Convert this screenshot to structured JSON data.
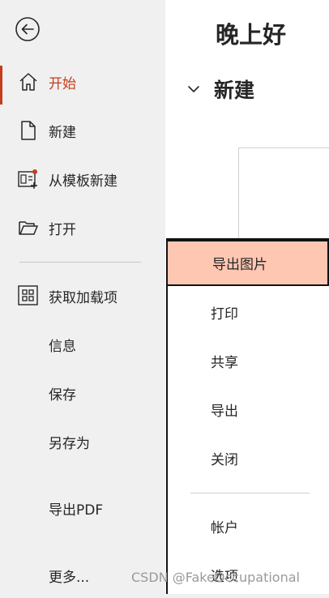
{
  "sidebar": {
    "back": {
      "icon": "back-arrow-icon"
    },
    "items": [
      {
        "label": "开始",
        "icon": "home-icon",
        "active": true
      },
      {
        "label": "新建",
        "icon": "new-document-icon"
      },
      {
        "label": "从模板新建",
        "icon": "template-icon"
      },
      {
        "label": "打开",
        "icon": "folder-open-icon"
      },
      {
        "label": "获取加载项",
        "icon": "addins-grid-icon"
      },
      {
        "label": "信息"
      },
      {
        "label": "保存"
      },
      {
        "label": "另存为"
      },
      {
        "label": "导出PDF"
      },
      {
        "label": "更多..."
      }
    ]
  },
  "main": {
    "greeting": "晚上好",
    "section_title": "新建"
  },
  "more_menu": {
    "items": [
      {
        "label": "导出图片",
        "highlighted": true
      },
      {
        "label": "打印"
      },
      {
        "label": "共享"
      },
      {
        "label": "导出"
      },
      {
        "label": "关闭"
      },
      {
        "label": "帐户"
      },
      {
        "label": "选项"
      }
    ]
  },
  "watermark": "CSDN @FakeOccupational",
  "colors": {
    "accent": "#c43e1c",
    "highlight": "#fdc7b2",
    "sidebar_bg": "#f0f0f0"
  }
}
